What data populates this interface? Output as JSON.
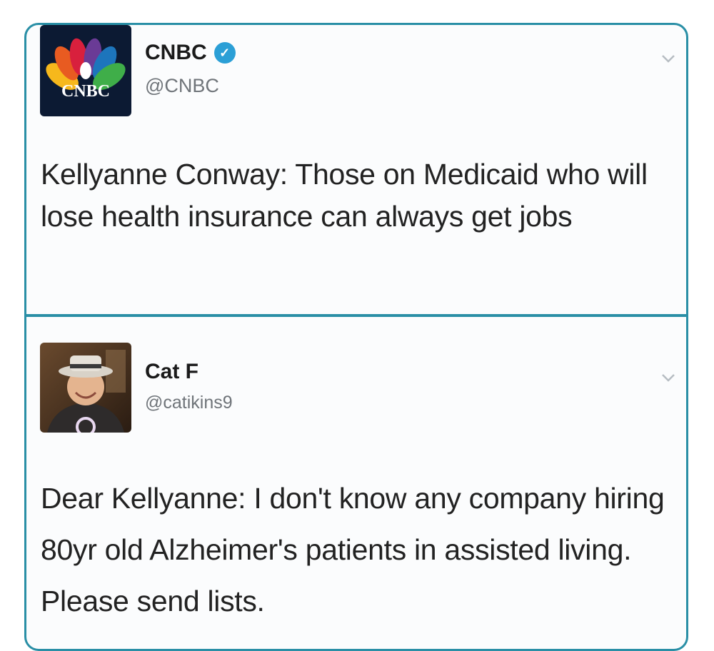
{
  "tweets": [
    {
      "display_name": "CNBC",
      "verified": true,
      "handle": "@CNBC",
      "avatar_logo_text": "CNBC",
      "text": "Kellyanne Conway: Those on Medicaid who will lose health insurance can always get jobs",
      "menu_icon": "chevron-down-icon"
    },
    {
      "display_name": "Cat F",
      "verified": false,
      "handle": "@catikins9",
      "text": "Dear Kellyanne: I don't know any company hiring 80yr old Alzheimer's patients in assisted living. Please send lists.",
      "menu_icon": "chevron-down-icon"
    }
  ],
  "colors": {
    "frame_border": "#2a8fa6",
    "verified_badge": "#2b9fd6",
    "handle_text": "#6f7479"
  }
}
